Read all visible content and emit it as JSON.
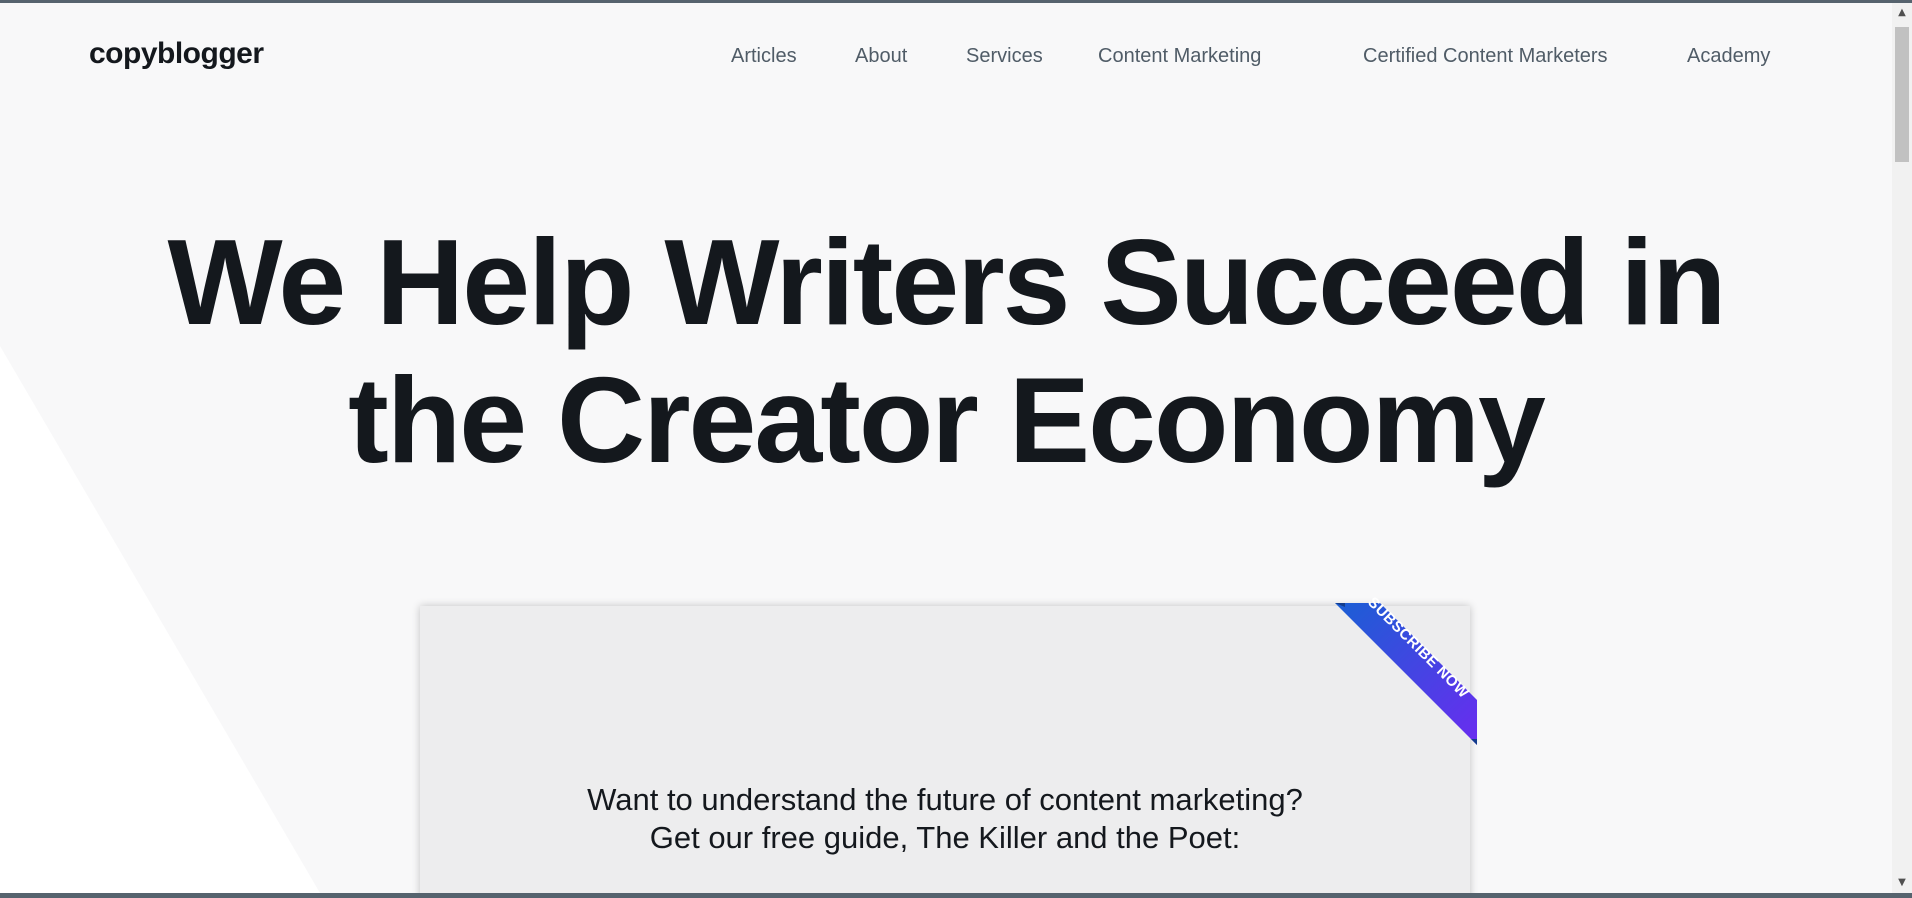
{
  "header": {
    "logo": "copyblogger",
    "nav": [
      {
        "label": "Articles",
        "name": "nav-articles"
      },
      {
        "label": "About",
        "name": "nav-about"
      },
      {
        "label": "Services",
        "name": "nav-services"
      },
      {
        "label": "Content Marketing",
        "name": "nav-content-marketing"
      },
      {
        "label": "Certified Content Marketers",
        "name": "nav-certified-content-marketers"
      },
      {
        "label": "Academy",
        "name": "nav-academy"
      }
    ]
  },
  "hero": {
    "line1": "We Help Writers Succeed in",
    "line2": "the Creator Economy"
  },
  "card": {
    "ribbon": "SUBSCRIBE NOW",
    "line1": "Want to understand the future of content marketing?",
    "line2": "Get our free guide, The Killer and the Poet:"
  },
  "colors": {
    "background": "#f8f8f9",
    "text": "#14181d",
    "nav_text": "#505c67",
    "card_bg": "#ededee",
    "ribbon_start": "#1a5fd4",
    "ribbon_end": "#6a2cf0"
  },
  "icons": {
    "scroll_up": "triangle-up-icon",
    "scroll_down": "triangle-down-icon"
  }
}
